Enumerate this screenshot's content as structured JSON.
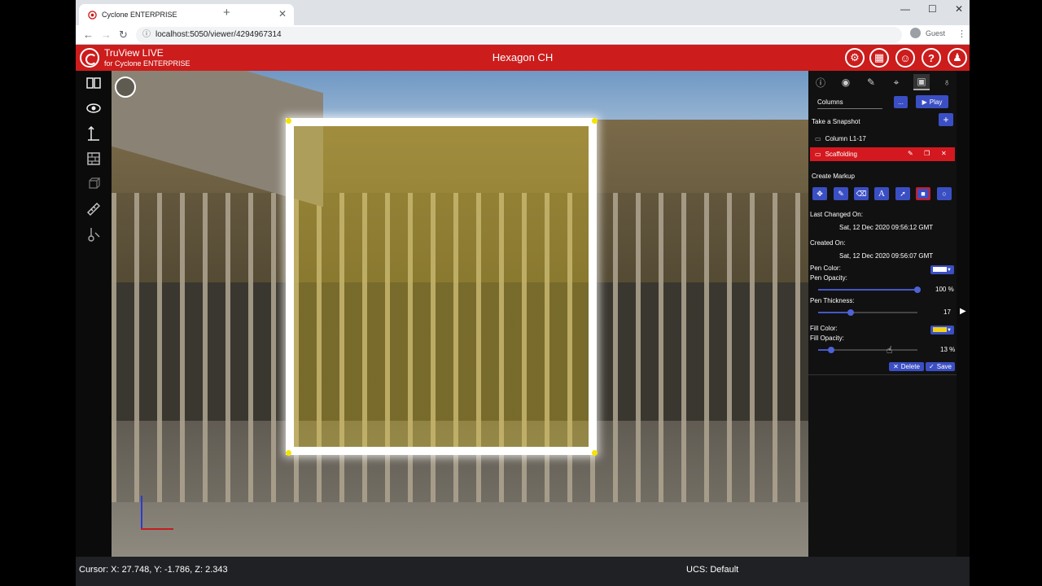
{
  "browser": {
    "tab_title": "Cyclone ENTERPRISE",
    "tab_close": "✕",
    "new_tab": "+",
    "url": "localhost:5050/viewer/4294967314",
    "profile": "Guest",
    "controls": {
      "minimize": "—",
      "maximize": "☐",
      "close": "✕"
    }
  },
  "app": {
    "brand_title": "TruView LIVE",
    "brand_subtitle": "for Cyclone ENTERPRISE",
    "title": "Hexagon CH",
    "header_buttons": [
      "settings-icon",
      "layout-icon",
      "user-settings-icon",
      "help-icon",
      "account-icon"
    ]
  },
  "left_toolbar": [
    "book-icon",
    "eye-icon",
    "measure-height-icon",
    "wall-icon",
    "cube-icon",
    "ruler-icon",
    "pick-icon"
  ],
  "panel": {
    "tabs": [
      "info-icon",
      "eye-icon",
      "attachment-icon",
      "location-icon",
      "snapshot-icon",
      "lightbulb-icon"
    ],
    "active_tab": 4,
    "group_select": "Columns",
    "group_more": "...",
    "play_label": "Play",
    "take_snapshot_label": "Take a Snapshot",
    "add_label": "+",
    "snapshots": [
      {
        "name": "Column L1-17",
        "active": false
      },
      {
        "name": "Scaffolding",
        "active": true
      }
    ],
    "create_markup_label": "Create Markup",
    "markup_tools": [
      "move-icon",
      "pencil-icon",
      "eraser-icon",
      "text-icon",
      "arrow-icon",
      "rectangle-icon",
      "circle-icon"
    ],
    "active_markup_tool": 5,
    "last_changed_label": "Last Changed On:",
    "last_changed_value": "Sat, 12 Dec 2020 09:56:12 GMT",
    "created_label": "Created On:",
    "created_value": "Sat, 12 Dec 2020 09:56:07 GMT",
    "pen_color_label": "Pen Color:",
    "pen_color": "#ffffff",
    "pen_opacity_label": "Pen Opacity:",
    "pen_opacity_value": "100 %",
    "pen_opacity_fraction": 1.0,
    "pen_thickness_label": "Pen Thickness:",
    "pen_thickness_value": "17",
    "pen_thickness_fraction": 0.33,
    "fill_color_label": "Fill Color:",
    "fill_color": "#f2d318",
    "fill_opacity_label": "Fill Opacity:",
    "fill_opacity_value": "13 %",
    "fill_opacity_fraction": 0.13,
    "delete_label": "Delete",
    "save_label": "Save"
  },
  "status": {
    "cursor": "Cursor: X: 27.748, Y: -1.786, Z: 2.343",
    "ucs": "UCS: Default"
  },
  "colors": {
    "brand_red": "#cc1c1c",
    "accent_blue": "#3b4fc4",
    "markup_fill": "#f2d318"
  }
}
